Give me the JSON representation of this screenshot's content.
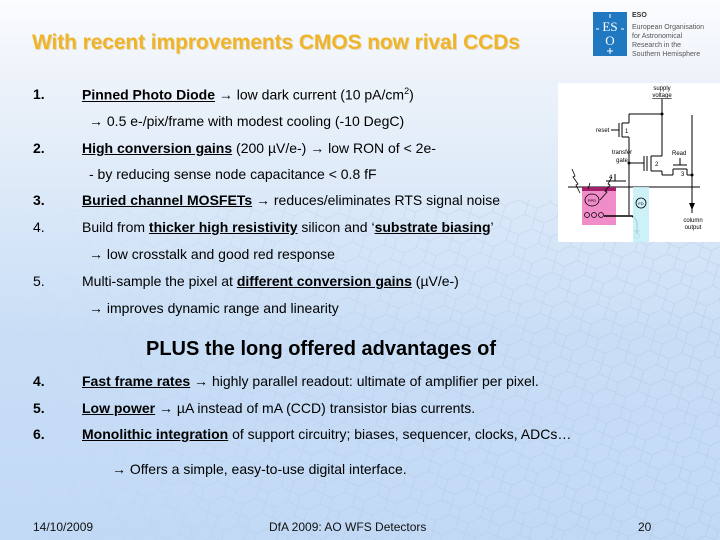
{
  "slide": {
    "title": "With recent improvements CMOS now rival CCDs",
    "logo": {
      "icon": "eso-logo",
      "name": "ESO",
      "lines": [
        "European Organisation",
        "for Astronomical",
        "Research in the",
        "Southern Hemisphere"
      ],
      "color": "#1f78c0"
    },
    "title_color": "#f0b429",
    "items_top": [
      {
        "num": "1.",
        "parts": {
          "lead": "Pinned Photo Diode",
          "rest": " → low dark current (10 pA/cm",
          "sup": "2",
          "tail": ")"
        }
      },
      {
        "sub": "→  0.5 e-/pix/frame with modest cooling (-10 DegC)"
      },
      {
        "num": "2.",
        "parts": {
          "lead": "High conversion gains",
          "rest": " (200 µV/e-) → low RON of < 2e-"
        }
      },
      {
        "sub": "-  by reducing sense node capacitance < 0.8 fF"
      },
      {
        "num": "3.",
        "parts": {
          "lead": "Buried channel MOSFETs",
          "rest": " →  reduces/eliminates RTS signal noise"
        }
      },
      {
        "num": "4.",
        "parts": {
          "pre": "Build from ",
          "lead": "thicker high resistivity",
          "mid": " silicon and ‘",
          "lead2": "substrate biasing",
          "tail": "’"
        }
      },
      {
        "sub": "→  low crosstalk and good red response"
      },
      {
        "num": "5.",
        "parts": {
          "pre": "Multi-sample the pixel at ",
          "lead": "different conversion gains",
          "rest": " (µV/e-)"
        }
      },
      {
        "sub": "→   improves dynamic range and linearity"
      }
    ],
    "plus_heading": "PLUS the long offered advantages of",
    "items_bottom": [
      {
        "num": "4.",
        "lead": "Fast frame rates",
        "rest": " → highly parallel readout: ultimate of amplifier per pixel."
      },
      {
        "num": "5.",
        "lead": "Low power",
        "rest": " → µA instead of mA (CCD) transistor bias currents."
      },
      {
        "num": "6.",
        "lead": "Monolithic integration",
        "rest": " of support circuitry; biases, sequencer, clocks, ADCs…"
      }
    ],
    "final_sub": "→ Offers a simple, easy-to-use digital interface.",
    "diagram": {
      "labels": {
        "supply": "supply",
        "voltage": "voltage",
        "reset": "reset",
        "transfer": "transfer",
        "gate": "gate",
        "read": "Read",
        "column": "column",
        "output": "output",
        "t1": "1",
        "t2": "2",
        "t3": "3",
        "t4": "4",
        "ppd": "PPD",
        "fd": "FD"
      },
      "colors": {
        "ppd_region": "#f08cc8",
        "ppd_top": "#a0206a",
        "fd_region": "#c8f0f8"
      }
    },
    "footer": {
      "date": "14/10/2009",
      "center": "DfA 2009: AO WFS Detectors",
      "page": "20"
    }
  }
}
